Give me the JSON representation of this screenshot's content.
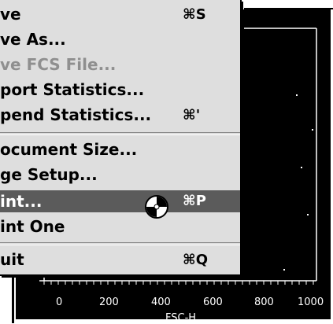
{
  "menu": {
    "items": [
      {
        "label": "ve",
        "shortcut": "⌘S",
        "enabled": true
      },
      {
        "label": "ve As...",
        "shortcut": "",
        "enabled": true
      },
      {
        "label": "ve FCS File...",
        "shortcut": "",
        "enabled": false
      },
      {
        "label": "port Statistics...",
        "shortcut": "",
        "enabled": true
      },
      {
        "label": "pend Statistics...",
        "shortcut": "⌘'",
        "enabled": true
      },
      {
        "label": "ocument Size...",
        "shortcut": "",
        "enabled": true
      },
      {
        "label": "ge Setup...",
        "shortcut": "",
        "enabled": true
      },
      {
        "label": "int...",
        "shortcut": "⌘P",
        "enabled": true,
        "highlighted": true
      },
      {
        "label": "int One",
        "shortcut": "",
        "enabled": true
      },
      {
        "label": "uit",
        "shortcut": "⌘Q",
        "enabled": true
      }
    ]
  },
  "plot": {
    "xlabel": "FSC-H",
    "xticks": [
      "0",
      "200",
      "400",
      "600",
      "800",
      "1000"
    ],
    "background": "#000000",
    "foreground": "#ffffff"
  },
  "cursor": {
    "icon": "busy-watch-icon"
  }
}
